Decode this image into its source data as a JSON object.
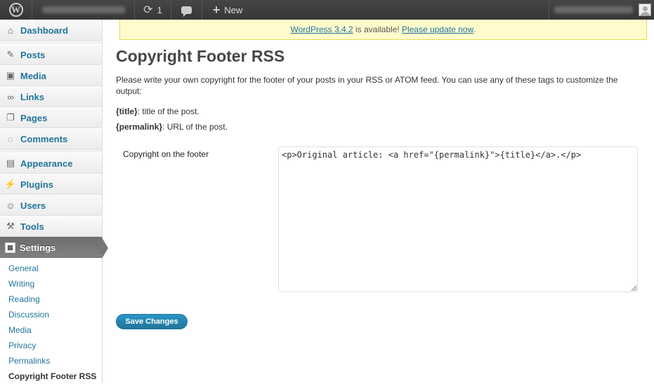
{
  "adminbar": {
    "updates_count": "1",
    "new_label": "New"
  },
  "sidebar": {
    "items": [
      {
        "label": "Dashboard",
        "icon": "dashboard-icon"
      },
      {
        "label": "Posts",
        "icon": "pin-icon"
      },
      {
        "label": "Media",
        "icon": "media-icon"
      },
      {
        "label": "Links",
        "icon": "link-icon"
      },
      {
        "label": "Pages",
        "icon": "pages-icon"
      },
      {
        "label": "Comments",
        "icon": "comment-icon"
      },
      {
        "label": "Appearance",
        "icon": "appearance-icon"
      },
      {
        "label": "Plugins",
        "icon": "plugin-icon"
      },
      {
        "label": "Users",
        "icon": "users-icon"
      },
      {
        "label": "Tools",
        "icon": "tools-icon"
      },
      {
        "label": "Settings",
        "icon": "settings-icon"
      }
    ],
    "submenu": [
      "General",
      "Writing",
      "Reading",
      "Discussion",
      "Media",
      "Privacy",
      "Permalinks",
      "Copyright Footer RSS"
    ]
  },
  "notice": {
    "version_link": "WordPress 3.4.2",
    "middle": " is available! ",
    "update_link": "Please update now",
    "end": "."
  },
  "page": {
    "title": "Copyright Footer RSS",
    "description": "Please write your own copyright for the footer of your posts in your RSS or ATOM feed. You can use any of these tags to customize the output:",
    "tag1_name": "{title}",
    "tag1_desc": ": title of the post.",
    "tag2_name": "{permalink}",
    "tag2_desc": ": URL of the post.",
    "field_label": "Copyright on the footer",
    "field_value": "<p>Original article: <a href=\"{permalink}\">{title}</a>.</p>",
    "save_label": "Save Changes"
  },
  "colors": {
    "link": "#21759b",
    "adminbar": "#464646",
    "notice_bg": "#fffbcc",
    "button": "#21759b"
  }
}
